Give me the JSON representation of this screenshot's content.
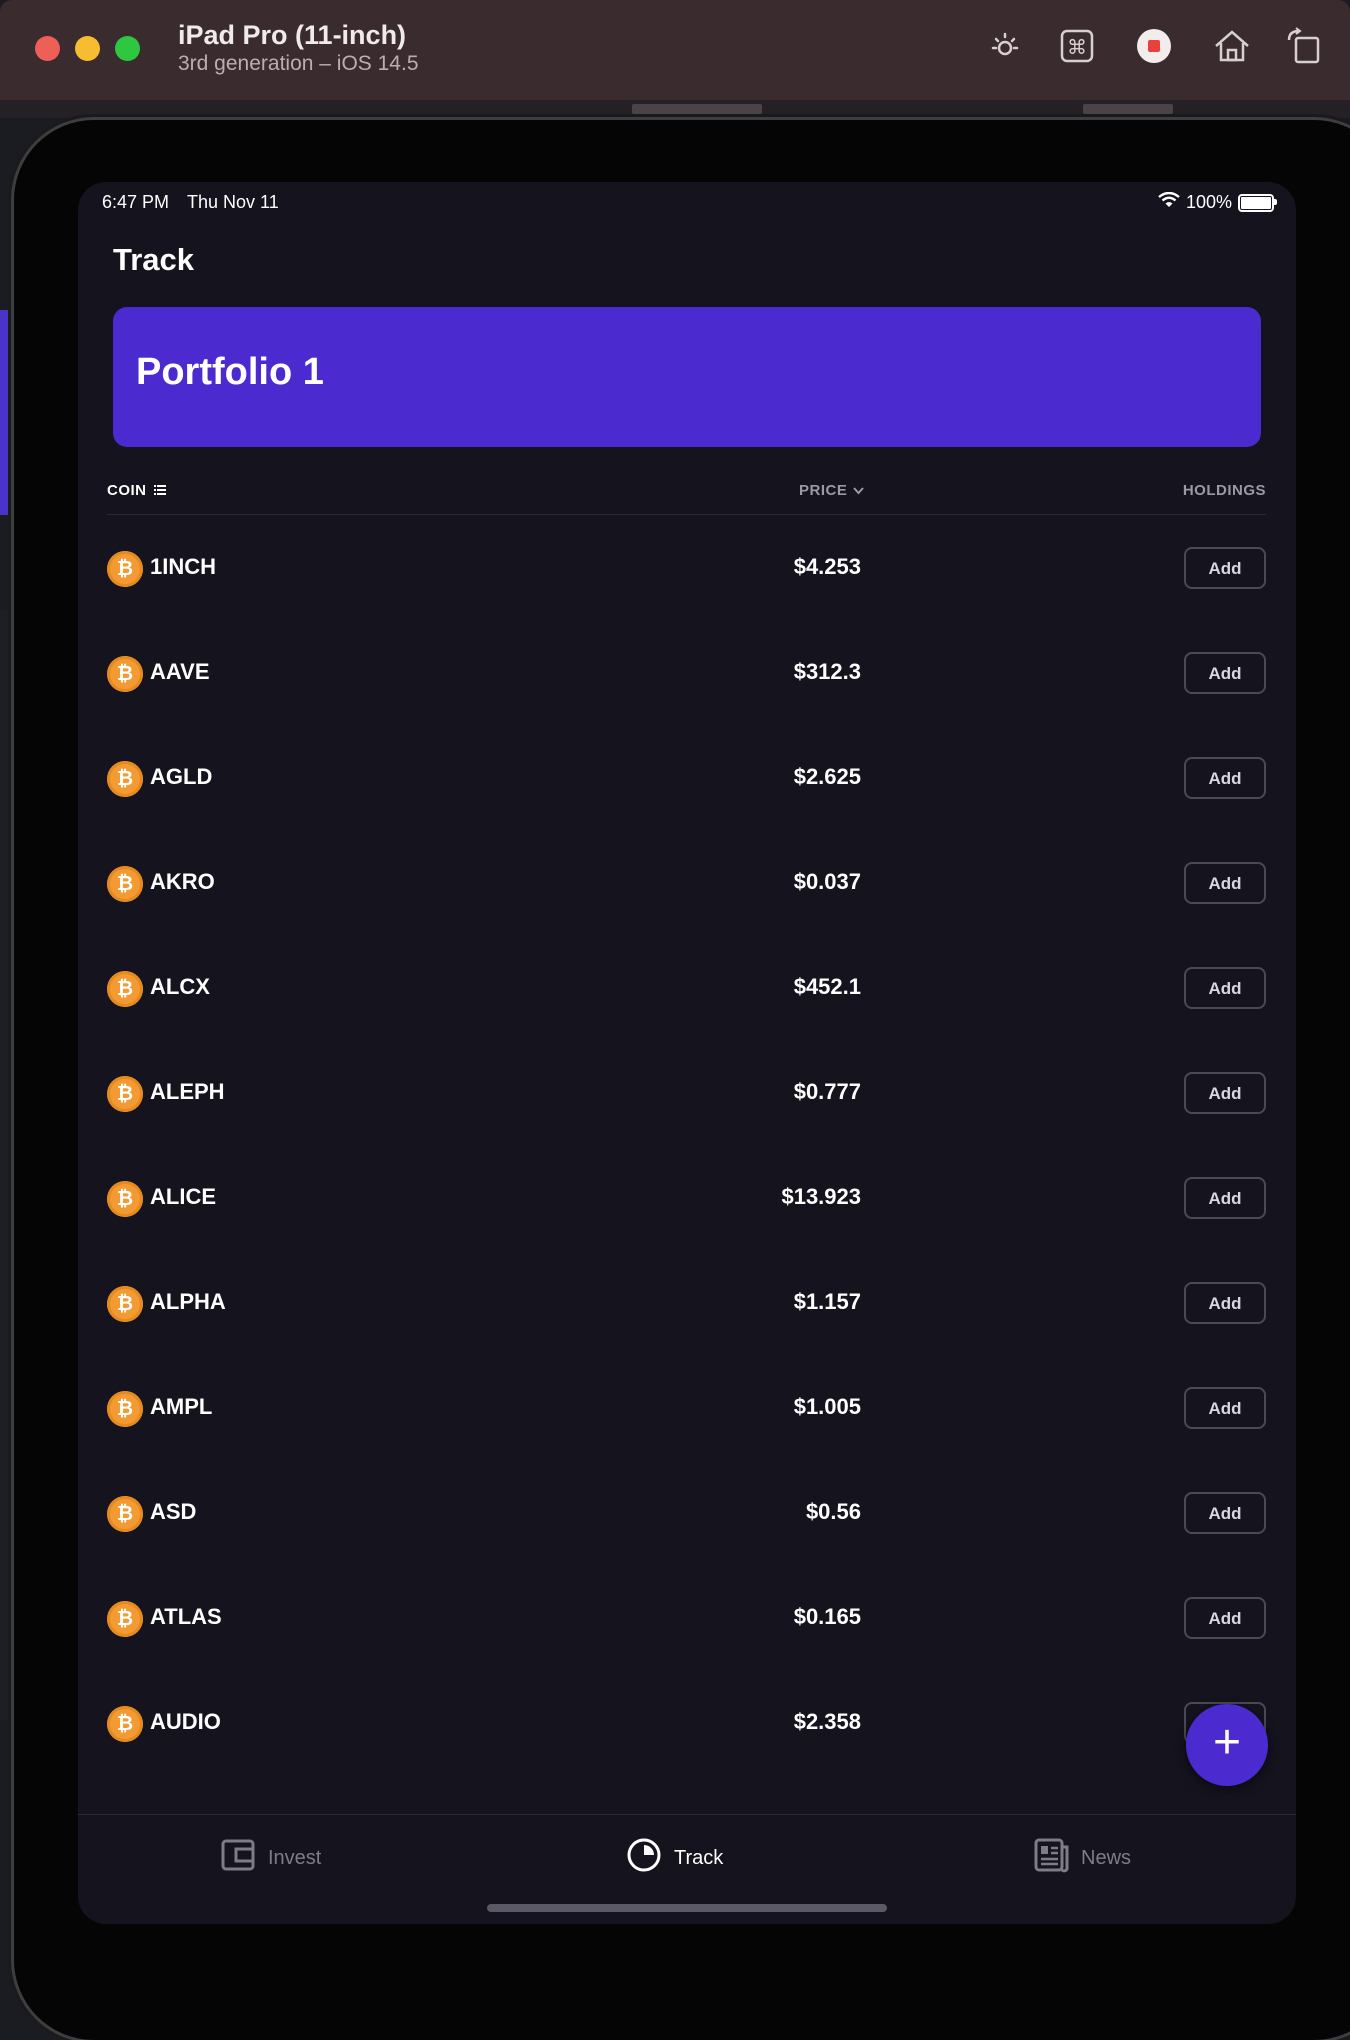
{
  "simulator": {
    "device_name": "iPad Pro (11-inch)",
    "device_subtitle": "3rd generation – iOS 14.5"
  },
  "status_bar": {
    "time": "6:47 PM",
    "date": "Thu Nov 11",
    "battery": "100%"
  },
  "page": {
    "title": "Track",
    "portfolio_name": "Portfolio 1"
  },
  "table": {
    "headers": {
      "coin": "COIN",
      "price": "PRICE",
      "holdings": "HOLDINGS"
    },
    "rows": [
      {
        "name": "1INCH",
        "price": "$4.253",
        "action": "Add"
      },
      {
        "name": "AAVE",
        "price": "$312.3",
        "action": "Add"
      },
      {
        "name": "AGLD",
        "price": "$2.625",
        "action": "Add"
      },
      {
        "name": "AKRO",
        "price": "$0.037",
        "action": "Add"
      },
      {
        "name": "ALCX",
        "price": "$452.1",
        "action": "Add"
      },
      {
        "name": "ALEPH",
        "price": "$0.777",
        "action": "Add"
      },
      {
        "name": "ALICE",
        "price": "$13.923",
        "action": "Add"
      },
      {
        "name": "ALPHA",
        "price": "$1.157",
        "action": "Add"
      },
      {
        "name": "AMPL",
        "price": "$1.005",
        "action": "Add"
      },
      {
        "name": "ASD",
        "price": "$0.56",
        "action": "Add"
      },
      {
        "name": "ATLAS",
        "price": "$0.165",
        "action": "Add"
      },
      {
        "name": "AUDIO",
        "price": "$2.358",
        "action": "Add"
      }
    ]
  },
  "fab": {
    "label": "+"
  },
  "tabbar": {
    "invest": "Invest",
    "track": "Track",
    "news": "News"
  },
  "colors": {
    "accent": "#4b2ad0",
    "background": "#14131e",
    "coin_icon": "#f39b32"
  }
}
